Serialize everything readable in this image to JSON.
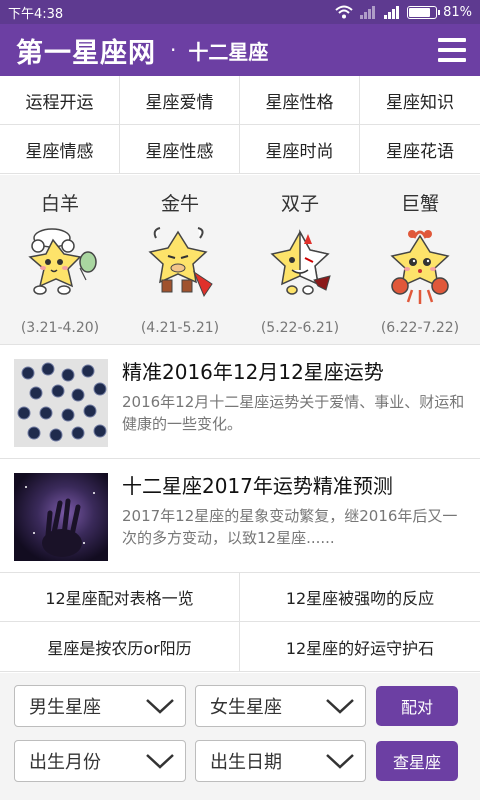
{
  "status": {
    "time": "下午4:38",
    "battery": "81%",
    "battery_level": 0.81
  },
  "header": {
    "logo": "第一星座网",
    "separator": "·",
    "subtitle": "十二星座"
  },
  "categories": [
    "运程开运",
    "星座爱情",
    "星座性格",
    "星座知识",
    "星座情感",
    "星座性感",
    "星座时尚",
    "星座花语"
  ],
  "zodiacs": [
    {
      "name": "白羊",
      "date": "(3.21-4.20)"
    },
    {
      "name": "金牛",
      "date": "(4.21-5.21)"
    },
    {
      "name": "双子",
      "date": "(5.22-6.21)"
    },
    {
      "name": "巨蟹",
      "date": "(6.22-7.22)"
    }
  ],
  "articles": [
    {
      "title": "精准2016年12月12星座运势",
      "desc": "2016年12月十二星座运势关于爱情、事业、财运和健康的一些变化。"
    },
    {
      "title": "十二星座2017年运势精准预测",
      "desc": "2017年12星座的星象变动繁复，继2016年后又一次的多方变动，以致12星座......"
    }
  ],
  "links": [
    "12星座配对表格一览",
    "12星座被强吻的反应",
    "星座是按农历or阳历",
    "12星座的好运守护石"
  ],
  "form": {
    "male_select": "男生星座",
    "female_select": "女生星座",
    "match_button": "配对",
    "month_select": "出生月份",
    "day_select": "出生日期",
    "lookup_button": "查星座"
  },
  "colors": {
    "brand": "#6c3fa3",
    "status_bar": "#5e3a90",
    "mascot": "#fde36a"
  }
}
